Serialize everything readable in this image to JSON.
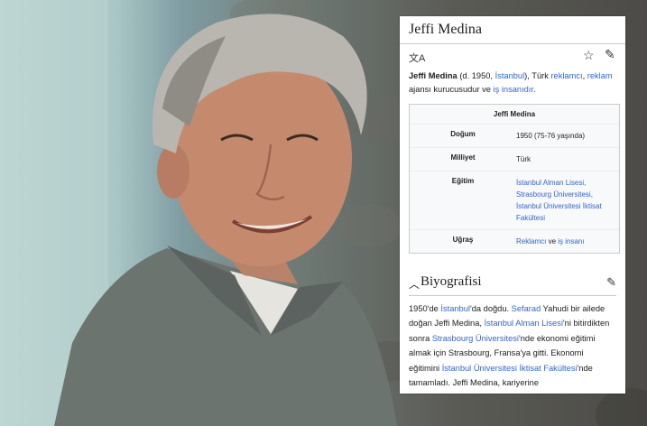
{
  "article": {
    "title": "Jeffi Medina",
    "tools": {
      "lang_icon": "translate-icon",
      "star_icon": "star-icon",
      "edit_icon": "pencil-icon"
    },
    "lead": {
      "name": "Jeffi Medina",
      "t1": " (d. 1950, ",
      "l1": "İstanbul",
      "t2": "), Türk ",
      "l2": "reklamcı",
      "t3": ", ",
      "l3": "reklam",
      "t4": " ajansı kurucusudur ve ",
      "l4": "iş insanıdır",
      "t5": "."
    },
    "infobox": {
      "title": "Jeffi Medina",
      "rows": [
        {
          "label": "Doğum",
          "value": "1950 (75-76 yaşında)"
        },
        {
          "label": "Milliyet",
          "value": "Türk"
        },
        {
          "label": "Eğitim",
          "links": [
            "İstanbul Alman Lisesi,",
            "Strasbourg Üniversitesi,",
            "İstanbul Üniversitesi İktisat Fakültesi"
          ]
        },
        {
          "label": "Uğraş",
          "l1": "Reklamcı",
          "t1": " ve ",
          "l2": "iş insanı"
        }
      ]
    },
    "section": {
      "title": "Biyografisi",
      "chev_icon": "chevron-up-icon",
      "edit_icon": "pencil-icon",
      "p": [
        {
          "t": "1950'de "
        },
        {
          "l": "İstanbul"
        },
        {
          "t": "'da doğdu. "
        },
        {
          "l": "Sefarad"
        },
        {
          "t": " Yahudi bir ailede doğan Jeffi Medina, "
        },
        {
          "l": "İstanbul Alman Lisesi"
        },
        {
          "t": "'ni bitirdikten sonra "
        },
        {
          "l": "Strasbourg Üniversitesi"
        },
        {
          "t": "'nde ekonomi eğitimi almak için Strasbourg, Fransa'ya gitti. Ekonomi eğitimini "
        },
        {
          "l": "İstanbul Üniversitesi İktisat Fakültesi"
        },
        {
          "t": "'nde tamamladı. Jeffi Medina, kariyerine"
        }
      ]
    }
  },
  "photo": {
    "subject": "smiling-man-portrait",
    "shirt_color": "#6c7470",
    "hair_color": "#b9b6b0",
    "skin_color": "#c58a6e"
  }
}
